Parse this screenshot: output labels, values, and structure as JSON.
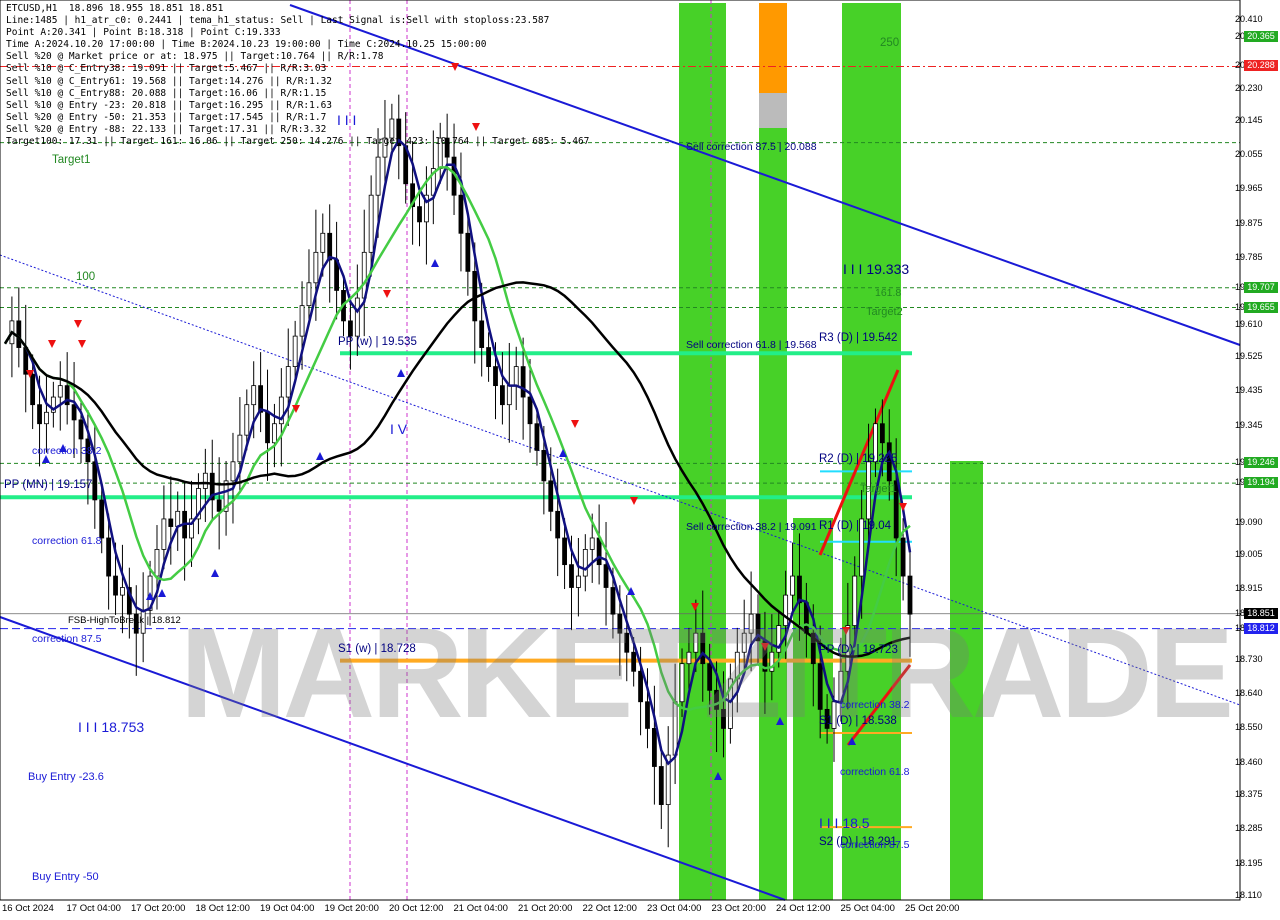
{
  "info_lines": [
    "ETCUSD,H1  18.896 18.955 18.851 18.851",
    "Line:1485 | h1_atr_c0: 0.2441 | tema_h1_status: Sell | Last Signal is:Sell with stoploss:23.587",
    "Point A:20.341 | Point B:18.318 | Point C:19.333",
    "Time A:2024.10.20 17:00:00 | Time B:2024.10.23 19:00:00 | Time C:2024.10.25 15:00:00",
    "Sell %20 @ Market price or at: 18.975 || Target:10.764 || R/R:1.78",
    "Sell %10 @ C_Entry38: 19.091 || Target:5.467 || R/R:3.03",
    "Sell %10 @ C_Entry61: 19.568 || Target:14.276 || R/R:1.32",
    "Sell %10 @ C_Entry88: 20.088 || Target:16.06 || R/R:1.15",
    "Sell %10 @ Entry -23: 20.818 || Target:16.295 || R/R:1.63",
    "Sell %20 @ Entry -50: 21.353 || Target:17.545 || R/R:1.7",
    "Sell %20 @ Entry -88: 22.133 || Target:17.31 || R/R:3.32",
    "Target100: 17.31 || Target 161: 16.06 || Target 250: 14.276 || Target 423: 10.764 || Target 685: 5.467"
  ],
  "watermark": "MARKETZITRADE",
  "colors": {
    "blue_channel": "#1a1ad6",
    "green_zone": "#33cc11",
    "orange_zone": "#ff9900",
    "pivot_green": "#22ee88",
    "orange_line": "#ffaa22",
    "cyan_line": "#22ddff",
    "red_axis_box": "#ee2222",
    "green_axis_box": "#22aa22",
    "blue_axis_box": "#2222ee"
  },
  "labels": {
    "target1": "Target1",
    "level_100": "100",
    "level_250": "250",
    "pp_weekly": "PP (w) | 19.535",
    "pp_monthly": "PP (MN) | 19.157",
    "s1_weekly": "S1 (w) | 18.728",
    "correction_38_left": "correction 38.2",
    "correction_61_left": "correction 61.8",
    "correction_87_left": "correction 87.5",
    "fsb_high": "FSB-HighToBreak | 18.812",
    "iii_18753": "I I I 18.753",
    "buy_entry_23": "Buy Entry -23.6",
    "buy_entry_50": "Buy Entry -50",
    "iii_top": "I I I",
    "iv": "I V",
    "sell_corr_87": "Sell correction 87.5 | 20.088",
    "sell_corr_61": "Sell correction 61.8 | 19.568",
    "sell_corr_38": "Sell correction 38.2 | 19.091",
    "iii_19333": "I I I 19.333",
    "fib_161": "161.8",
    "target2": "Target2",
    "r3_daily": "R3 (D) | 19.542",
    "r2_daily": "R2 (D) | 19.225",
    "target_mid": "Target1",
    "r1_daily": "R1 (D) | 19.04",
    "pp_daily": "PP (D) | 18.723",
    "correction_38_right": "correction 38.2",
    "s1_daily": "S1 (D) | 18.538",
    "correction_61_right": "correction 61.8",
    "iii_185": "I I I 18.5",
    "s2_daily": "S2 (D) | 18.291",
    "correction_87_right": "correction 87.5"
  },
  "price_axis": [
    "20.410",
    "20.365",
    "20.288",
    "20.230",
    "20.145",
    "20.055",
    "19.965",
    "19.875",
    "19.785",
    "19.707",
    "19.655",
    "19.610",
    "19.525",
    "19.435",
    "19.345",
    "19.246",
    "19.194",
    "19.090",
    "19.005",
    "18.915",
    "18.851",
    "18.812",
    "18.730",
    "18.640",
    "18.550",
    "18.460",
    "18.375",
    "18.285",
    "18.195",
    "18.110"
  ],
  "price_boxes": [
    {
      "value": "20.365",
      "color": "#22aa22"
    },
    {
      "value": "20.288",
      "color": "#ee2222"
    },
    {
      "value": "19.707",
      "color": "#22aa22"
    },
    {
      "value": "19.655",
      "color": "#22aa22"
    },
    {
      "value": "19.246",
      "color": "#22aa22"
    },
    {
      "value": "19.194",
      "color": "#22aa22"
    },
    {
      "value": "18.851",
      "color": "#000000"
    },
    {
      "value": "18.812",
      "color": "#2222ee"
    }
  ],
  "time_axis": [
    "16 Oct 2024",
    "17 Oct 04:00",
    "17 Oct 20:00",
    "18 Oct 12:00",
    "19 Oct 04:00",
    "19 Oct 20:00",
    "20 Oct 12:00",
    "21 Oct 04:00",
    "21 Oct 20:00",
    "22 Oct 12:00",
    "23 Oct 04:00",
    "23 Oct 20:00",
    "24 Oct 12:00",
    "25 Oct 04:00",
    "25 Oct 20:00"
  ],
  "chart_data": {
    "type": "candlestick",
    "symbol": "ETCUSD",
    "timeframe": "H1",
    "ohlc_last": {
      "open": 18.896,
      "high": 18.955,
      "low": 18.851,
      "close": 18.851
    },
    "ylim": [
      18.11,
      20.41
    ],
    "key_levels": {
      "pp_weekly": 19.535,
      "pp_monthly": 19.157,
      "s1_weekly": 18.728,
      "r3_daily": 19.542,
      "r2_daily": 19.225,
      "r1_daily": 19.04,
      "pp_daily": 18.723,
      "s1_daily": 18.538,
      "s2_daily": 18.291,
      "sell_corr_87": 20.088,
      "sell_corr_61": 19.568,
      "sell_corr_38": 19.091,
      "fsb_high": 18.812,
      "iii_19333": 19.333,
      "iii_18753": 18.753,
      "iii_185": 18.5
    },
    "close_series": [
      19.56,
      19.62,
      19.55,
      19.48,
      19.4,
      19.35,
      19.38,
      19.42,
      19.45,
      19.4,
      19.36,
      19.31,
      19.25,
      19.15,
      19.05,
      18.95,
      18.9,
      18.92,
      18.85,
      18.8,
      18.86,
      18.95,
      19.02,
      19.1,
      19.08,
      19.12,
      19.05,
      19.1,
      19.18,
      19.22,
      19.15,
      19.12,
      19.2,
      19.25,
      19.32,
      19.4,
      19.45,
      19.38,
      19.3,
      19.35,
      19.42,
      19.5,
      19.58,
      19.66,
      19.72,
      19.8,
      19.85,
      19.78,
      19.7,
      19.62,
      19.58,
      19.68,
      19.8,
      19.95,
      20.05,
      20.1,
      20.15,
      20.08,
      19.98,
      19.92,
      19.88,
      19.95,
      20.02,
      20.1,
      20.05,
      19.95,
      19.85,
      19.75,
      19.62,
      19.55,
      19.5,
      19.45,
      19.4,
      19.45,
      19.5,
      19.42,
      19.35,
      19.28,
      19.2,
      19.12,
      19.05,
      18.98,
      18.92,
      18.95,
      19.02,
      19.05,
      18.98,
      18.92,
      18.85,
      18.8,
      18.75,
      18.7,
      18.62,
      18.55,
      18.45,
      18.35,
      18.48,
      18.62,
      18.72,
      18.75,
      18.8,
      18.72,
      18.65,
      18.6,
      18.55,
      18.68,
      18.75,
      18.8,
      18.85,
      18.78,
      18.7,
      18.75,
      18.82,
      18.9,
      18.95,
      18.88,
      18.8,
      18.72,
      18.6,
      18.55,
      18.62,
      18.7,
      18.82,
      18.95,
      19.1,
      19.25,
      19.35,
      19.3,
      19.2,
      19.05,
      18.95,
      18.85
    ]
  }
}
